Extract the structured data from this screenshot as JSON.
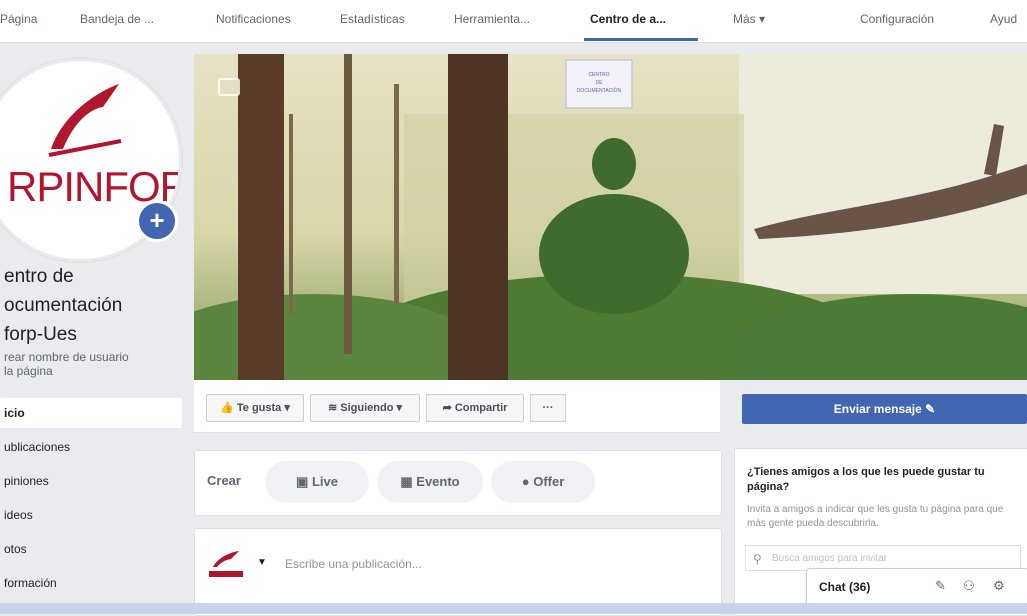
{
  "nav": {
    "items": [
      "Página",
      "Bandeja de ...",
      "Notificaciones",
      "Estadísticas",
      "Herramienta...",
      "Centro de a...",
      "Más ▾",
      "Configuración",
      "Ayud"
    ]
  },
  "page": {
    "logo_text": "RPINFORP-U",
    "name": "Centro de Documentación Inforp-Ues",
    "name_visible": "entro de\nocumentación\nforp-Ues",
    "handle": "rear nombre de usuario\nla página"
  },
  "leftnav": [
    "icio",
    "ublicaciones",
    "piniones",
    "ideos",
    "otos",
    "formación"
  ],
  "cover": {
    "sign_text": "CENTRO\nDE\nDOCUMENTACIÓN"
  },
  "actions": {
    "like": "Te gusta ▾",
    "follow": "Siguiendo ▾",
    "share": "Compartir",
    "more": "···",
    "send": "Enviar mensaje"
  },
  "create": {
    "label": "Crear",
    "live": "Live",
    "event": "Evento",
    "offer": "Offer"
  },
  "composer": {
    "placeholder": "Escribe una publicación..."
  },
  "invite": {
    "question": "¿Tienes amigos a los que les puede gustar tu página?",
    "desc": "Invita a amigos a indicar que les gusta tu página para que más gente pueda descubrirla.",
    "search_placeholder": "Busca amigos para invitar"
  },
  "chat": {
    "label": "Chat (36)"
  },
  "colors": {
    "brand": "#4267b2",
    "logo_red": "#b0162d"
  }
}
